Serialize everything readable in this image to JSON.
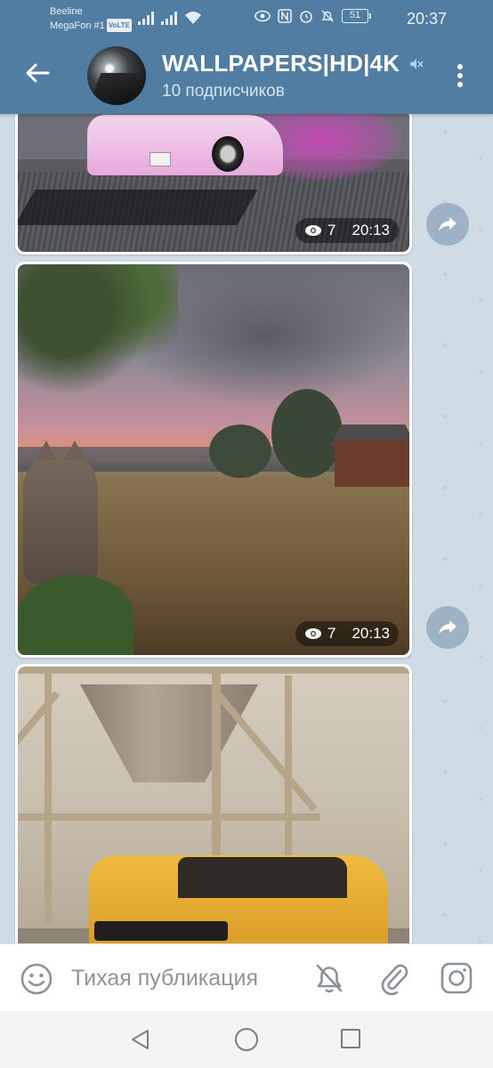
{
  "status_bar": {
    "carrier_1": "Beeline",
    "carrier_2": "MegaFon #1",
    "volte_badge": "VoLTE",
    "battery": "51",
    "time": "20:37"
  },
  "header": {
    "channel_title": "WALLPAPERS|HD|4K",
    "subscribers": "10 подписчиков",
    "muted_icon": "speaker-muted-icon",
    "menu_icon": "three-dots-icon"
  },
  "posts": [
    {
      "views": "7",
      "time": "20:13",
      "image": "pink-car-drift-smoke"
    },
    {
      "views": "7",
      "time": "20:13",
      "image": "cat-field-sunset"
    },
    {
      "image": "yellow-bmw-industrial"
    }
  ],
  "input_bar": {
    "placeholder": "Тихая публикация"
  },
  "colors": {
    "header_bg": "#517da2",
    "chat_bg": "#cfdbe5"
  }
}
